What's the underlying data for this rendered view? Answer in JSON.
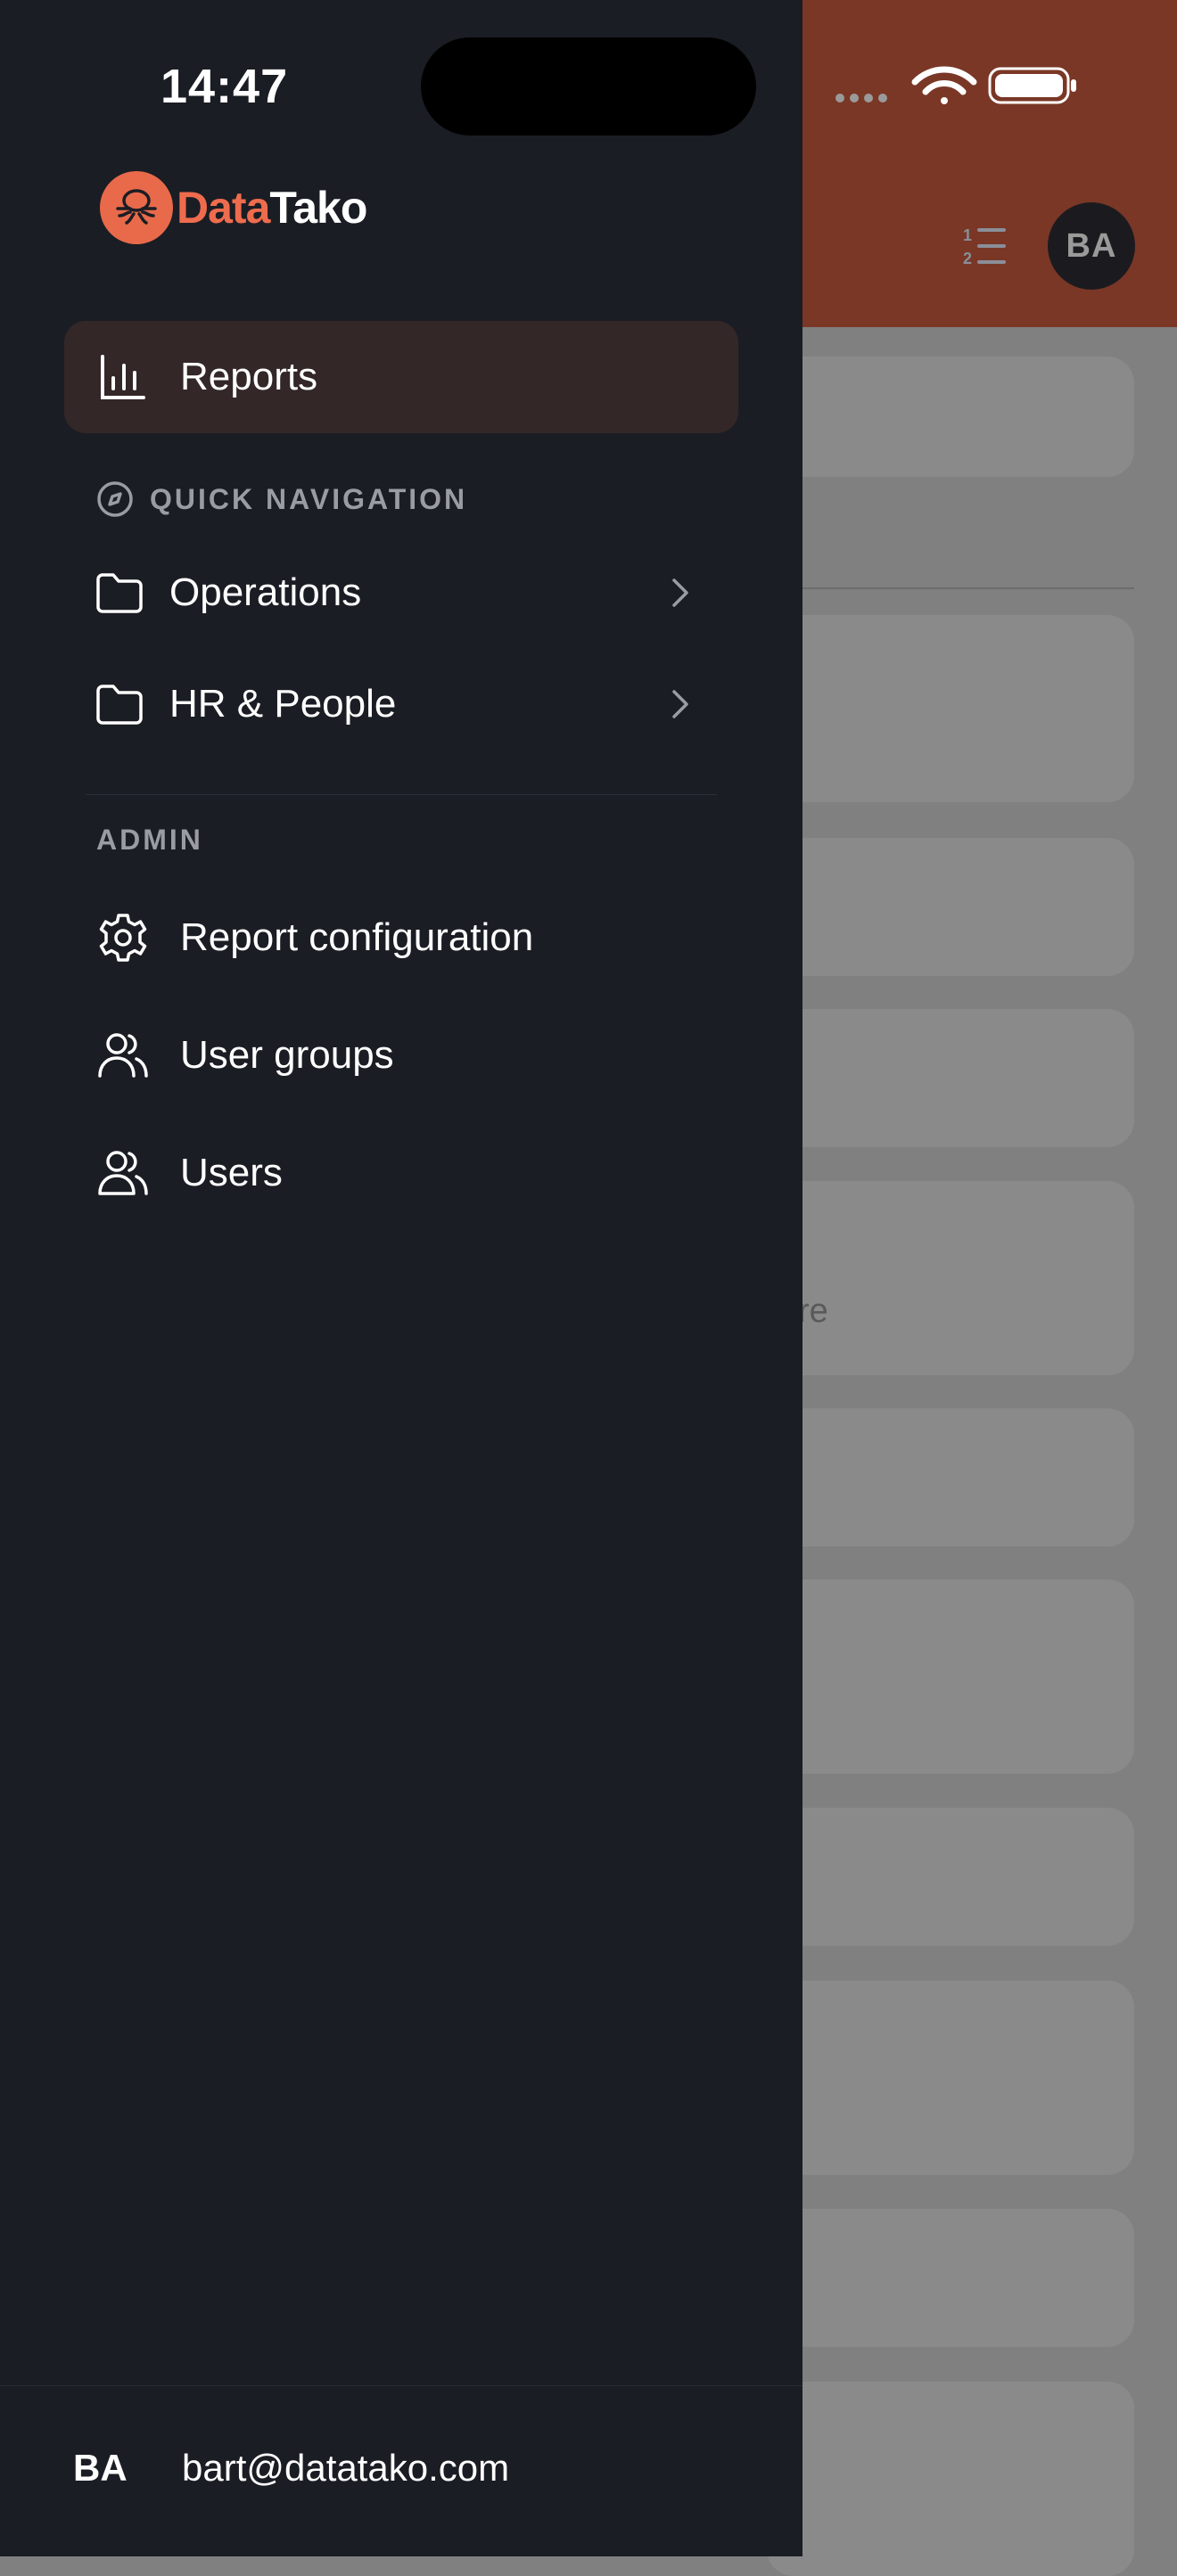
{
  "status_bar": {
    "time": "14:47"
  },
  "background": {
    "avatar_initials": "BA",
    "partial_text": "re"
  },
  "drawer": {
    "brand": {
      "part1": "Data",
      "part2": "Tako"
    },
    "reports_label": "Reports",
    "quick_nav": {
      "title": "QUICK NAVIGATION",
      "items": [
        {
          "label": "Operations"
        },
        {
          "label": "HR & People"
        }
      ]
    },
    "admin": {
      "title": "ADMIN",
      "items": [
        {
          "label": "Report configuration"
        },
        {
          "label": "User groups"
        },
        {
          "label": "Users"
        }
      ]
    },
    "user": {
      "initials": "BA",
      "email": "bart@datatako.com"
    }
  },
  "colors": {
    "accent": "#ee6c4d",
    "header": "#7a3726",
    "drawer_bg": "#1b1d24",
    "active_item_bg": "#332728"
  }
}
